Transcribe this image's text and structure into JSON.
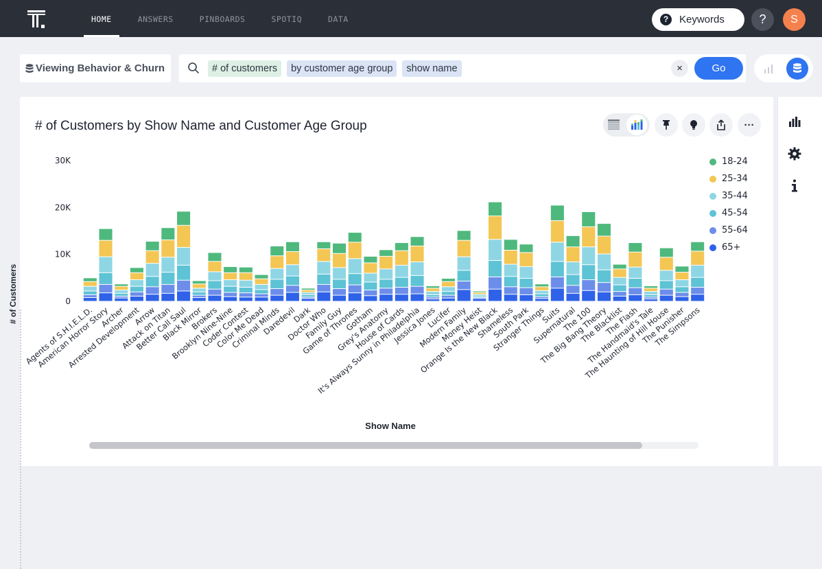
{
  "topnav": {
    "items": [
      {
        "label": "HOME",
        "active": true
      },
      {
        "label": "ANSWERS",
        "active": false
      },
      {
        "label": "PINBOARDS",
        "active": false
      },
      {
        "label": "SPOTIQ",
        "active": false
      },
      {
        "label": "DATA",
        "active": false
      }
    ],
    "keywords_label": "Keywords",
    "help_label": "?",
    "avatar_initial": "S"
  },
  "search": {
    "source_label": "Viewing Behavior & Churn",
    "tokens": [
      {
        "label": "# of customers",
        "kind": "measure"
      },
      {
        "label": "by customer age group",
        "kind": "attribute"
      },
      {
        "label": "show name",
        "kind": "attribute"
      }
    ],
    "clear_label": "×",
    "go_label": "Go"
  },
  "answer": {
    "title": "# of Customers by Show Name and Customer Age Group",
    "more_label": "···"
  },
  "colors": {
    "accent": "#2f74f0",
    "topbar": "#2b2f38",
    "series": [
      "#4fb97d",
      "#f4c654",
      "#8fd6e4",
      "#5ec3d5",
      "#6c8eea",
      "#2f62e8"
    ]
  },
  "chart_data": {
    "type": "bar",
    "stacked": true,
    "title": "# of Customers by Show Name and Customer Age Group",
    "xlabel": "Show Name",
    "ylabel": "# of Customers",
    "ylim": [
      0,
      30000
    ],
    "yticks": [
      {
        "value": 0,
        "label": "0"
      },
      {
        "value": 10000,
        "label": "10K"
      },
      {
        "value": 20000,
        "label": "20K"
      },
      {
        "value": 30000,
        "label": "30K"
      }
    ],
    "legend_position": "top-right",
    "grid": false,
    "categories": [
      "Agents of S.H.I.E.L.D.",
      "American Horror Story",
      "Archer",
      "Arrested Development",
      "Arrow",
      "Attack on Titan",
      "Better Call Saul",
      "Black Mirror",
      "Brokers",
      "Brooklyn Nine-Nine",
      "Coder Contest",
      "Color Me Dead",
      "Criminal Minds",
      "Daredevil",
      "Dark",
      "Doctor Who",
      "Family Guy",
      "Game of Thrones",
      "Gotham",
      "Grey's Anatomy",
      "House of Cards",
      "It's Always Sunny in Philadelphia",
      "Jessica Jones",
      "Lucifer",
      "Modern Family",
      "Money Heist",
      "Orange Is the New Black",
      "Shameless",
      "South Park",
      "Stranger Things",
      "Suits",
      "Supernatural",
      "The 100",
      "The Big Bang Theory",
      "The Blacklist",
      "The Flash",
      "The Handmaid's Tale",
      "The Haunting of Hill House",
      "The Punisher",
      "The Simpsons"
    ],
    "series": [
      {
        "name": "18-24",
        "values": [
          800,
          2500,
          500,
          1100,
          2000,
          2600,
          3000,
          700,
          1900,
          1300,
          1200,
          900,
          2100,
          2100,
          400,
          1500,
          2200,
          2100,
          1400,
          1400,
          1700,
          2000,
          500,
          700,
          2100,
          300,
          3000,
          2300,
          1800,
          600,
          3300,
          2400,
          3200,
          2700,
          1000,
          2000,
          500,
          2000,
          1300,
          2000
        ],
        "color": "#4fb97d"
      },
      {
        "name": "25-34",
        "values": [
          1000,
          3500,
          800,
          1500,
          2700,
          3700,
          4700,
          900,
          2200,
          1500,
          1600,
          1200,
          2700,
          2800,
          500,
          2700,
          3000,
          3500,
          2200,
          2700,
          3100,
          3400,
          700,
          1100,
          3500,
          400,
          5000,
          3000,
          3000,
          800,
          4600,
          3200,
          4300,
          3800,
          1800,
          3200,
          700,
          2800,
          1600,
          3000
        ],
        "color": "#f4c654"
      },
      {
        "name": "35-44",
        "values": [
          1000,
          3400,
          700,
          1400,
          2800,
          3200,
          3800,
          800,
          1900,
          1400,
          1500,
          1100,
          2300,
          2400,
          500,
          2700,
          2500,
          3200,
          1900,
          2200,
          2600,
          2900,
          700,
          1000,
          2900,
          400,
          4500,
          2600,
          2500,
          700,
          4100,
          2700,
          3800,
          3400,
          1600,
          2400,
          700,
          2200,
          1500,
          2600
        ],
        "color": "#8fd6e4"
      },
      {
        "name": "45-54",
        "values": [
          800,
          2500,
          600,
          1200,
          2200,
          2600,
          3200,
          700,
          1800,
          1300,
          1200,
          900,
          2000,
          2000,
          500,
          2200,
          2000,
          2400,
          1700,
          1900,
          2100,
          2300,
          500,
          800,
          2300,
          300,
          3500,
          2200,
          2000,
          600,
          3300,
          2300,
          3200,
          2700,
          1400,
          2000,
          500,
          1800,
          1200,
          2100
        ],
        "color": "#5ec3d5"
      },
      {
        "name": "55-64",
        "values": [
          600,
          1800,
          400,
          900,
          1600,
          1900,
          2300,
          500,
          1300,
          900,
          900,
          700,
          1400,
          1500,
          300,
          1600,
          1400,
          1700,
          1200,
          1300,
          1500,
          1600,
          400,
          600,
          1800,
          200,
          2600,
          1600,
          1500,
          400,
          2400,
          1700,
          2300,
          2000,
          1000,
          1500,
          400,
          1300,
          900,
          1500
        ],
        "color": "#6c8eea"
      },
      {
        "name": "65+",
        "values": [
          800,
          1800,
          700,
          1100,
          1500,
          1700,
          2200,
          800,
          1300,
          1000,
          900,
          900,
          1300,
          1900,
          600,
          2000,
          1300,
          1800,
          1200,
          1500,
          1500,
          1600,
          500,
          700,
          2500,
          600,
          2600,
          1500,
          1400,
          600,
          2800,
          1700,
          2300,
          2000,
          1100,
          1400,
          500,
          1300,
          1000,
          1500
        ],
        "color": "#2f62e8"
      }
    ]
  },
  "legend": [
    {
      "label": "18-24",
      "color": "#4fb97d"
    },
    {
      "label": "25-34",
      "color": "#f4c654"
    },
    {
      "label": "35-44",
      "color": "#8fd6e4"
    },
    {
      "label": "45-54",
      "color": "#5ec3d5"
    },
    {
      "label": "55-64",
      "color": "#6c8eea"
    },
    {
      "label": "65+",
      "color": "#2f62e8"
    }
  ],
  "icons": {
    "logo": "thoughtspot-logo",
    "keywords": "question-circle-icon",
    "search": "search-icon",
    "source": "database-icon",
    "table_view": "table-icon",
    "chart_view": "bar-chart-icon",
    "pin": "pin-icon",
    "insight": "lightbulb-icon",
    "share": "share-icon",
    "more": "more-icon",
    "side_chart": "chart-config-icon",
    "side_settings": "gear-icon",
    "side_info": "info-icon"
  }
}
